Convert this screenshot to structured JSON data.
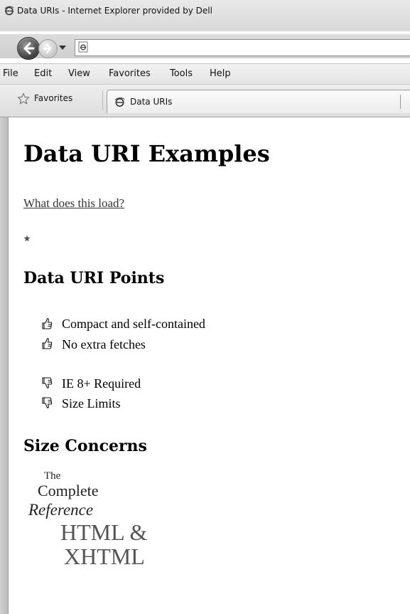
{
  "window": {
    "title": "Data URIs - Internet Explorer provided by Dell"
  },
  "menu": [
    "File",
    "Edit",
    "View",
    "Favorites",
    "Tools",
    "Help"
  ],
  "favorites_bar": {
    "favorites_label": "Favorites",
    "tab_label": "Data URIs"
  },
  "page": {
    "heading": "Data URI Examples",
    "link_text": "What does this load?",
    "section1_title": "Data URI Points",
    "pros": [
      "Compact and self-contained",
      "No extra fetches"
    ],
    "cons": [
      "IE 8+ Required",
      "Size Limits"
    ],
    "section2_title": "Size Concerns",
    "book_logo": {
      "line1": "The",
      "line2": "Complete",
      "line3": "Reference",
      "line4": "HTML &",
      "line5": "XHTML"
    }
  }
}
